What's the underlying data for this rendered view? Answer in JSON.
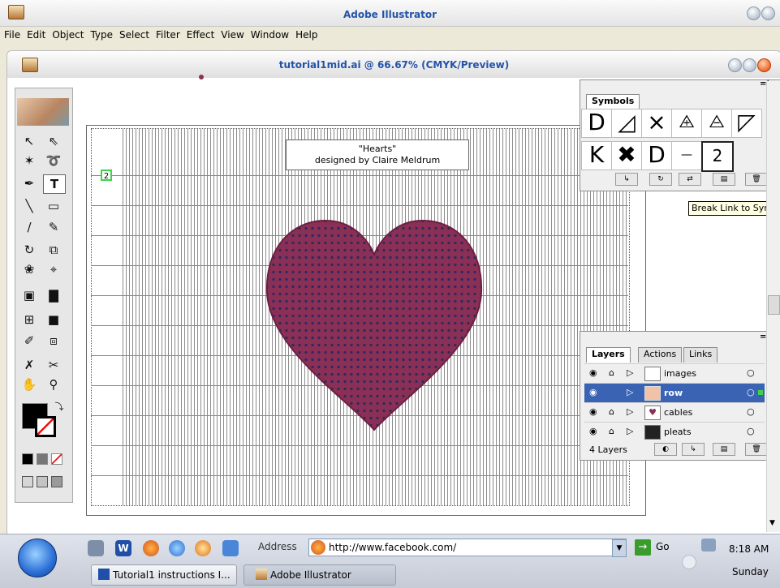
{
  "app": {
    "title": "Adobe Illustrator"
  },
  "menu": [
    "File",
    "Edit",
    "Object",
    "Type",
    "Select",
    "Filter",
    "Effect",
    "View",
    "Window",
    "Help"
  ],
  "document": {
    "title": "tutorial1mid.ai @ 66.67% (CMYK/Preview)"
  },
  "artboard": {
    "label_line1": "\"Hearts\"",
    "label_line2": "designed by Claire Meldrum",
    "row_marker": "2"
  },
  "symbols_panel": {
    "tab": "Symbols",
    "selected_symbol_value": "2",
    "tooltip": "Break Link to Symbol"
  },
  "layers_panel": {
    "tabs": [
      "Layers",
      "Actions",
      "Links"
    ],
    "layers": [
      {
        "name": "images",
        "selected": false
      },
      {
        "name": "row",
        "selected": true
      },
      {
        "name": "cables",
        "selected": false
      },
      {
        "name": "pleats",
        "selected": false
      }
    ],
    "count_label": "4 Layers"
  },
  "taskbar": {
    "address_label": "Address",
    "address_value": "http://www.facebook.com/",
    "go_label": "Go",
    "time": "8:18 AM",
    "day": "Sunday",
    "tasks": [
      "Tutorial1 instructions I...",
      "Adobe Illustrator"
    ]
  },
  "colors": {
    "title_text": "#2353a8",
    "row_line": "#e0625f",
    "heart": "#8a2f55",
    "selection": "#3b63b3"
  }
}
